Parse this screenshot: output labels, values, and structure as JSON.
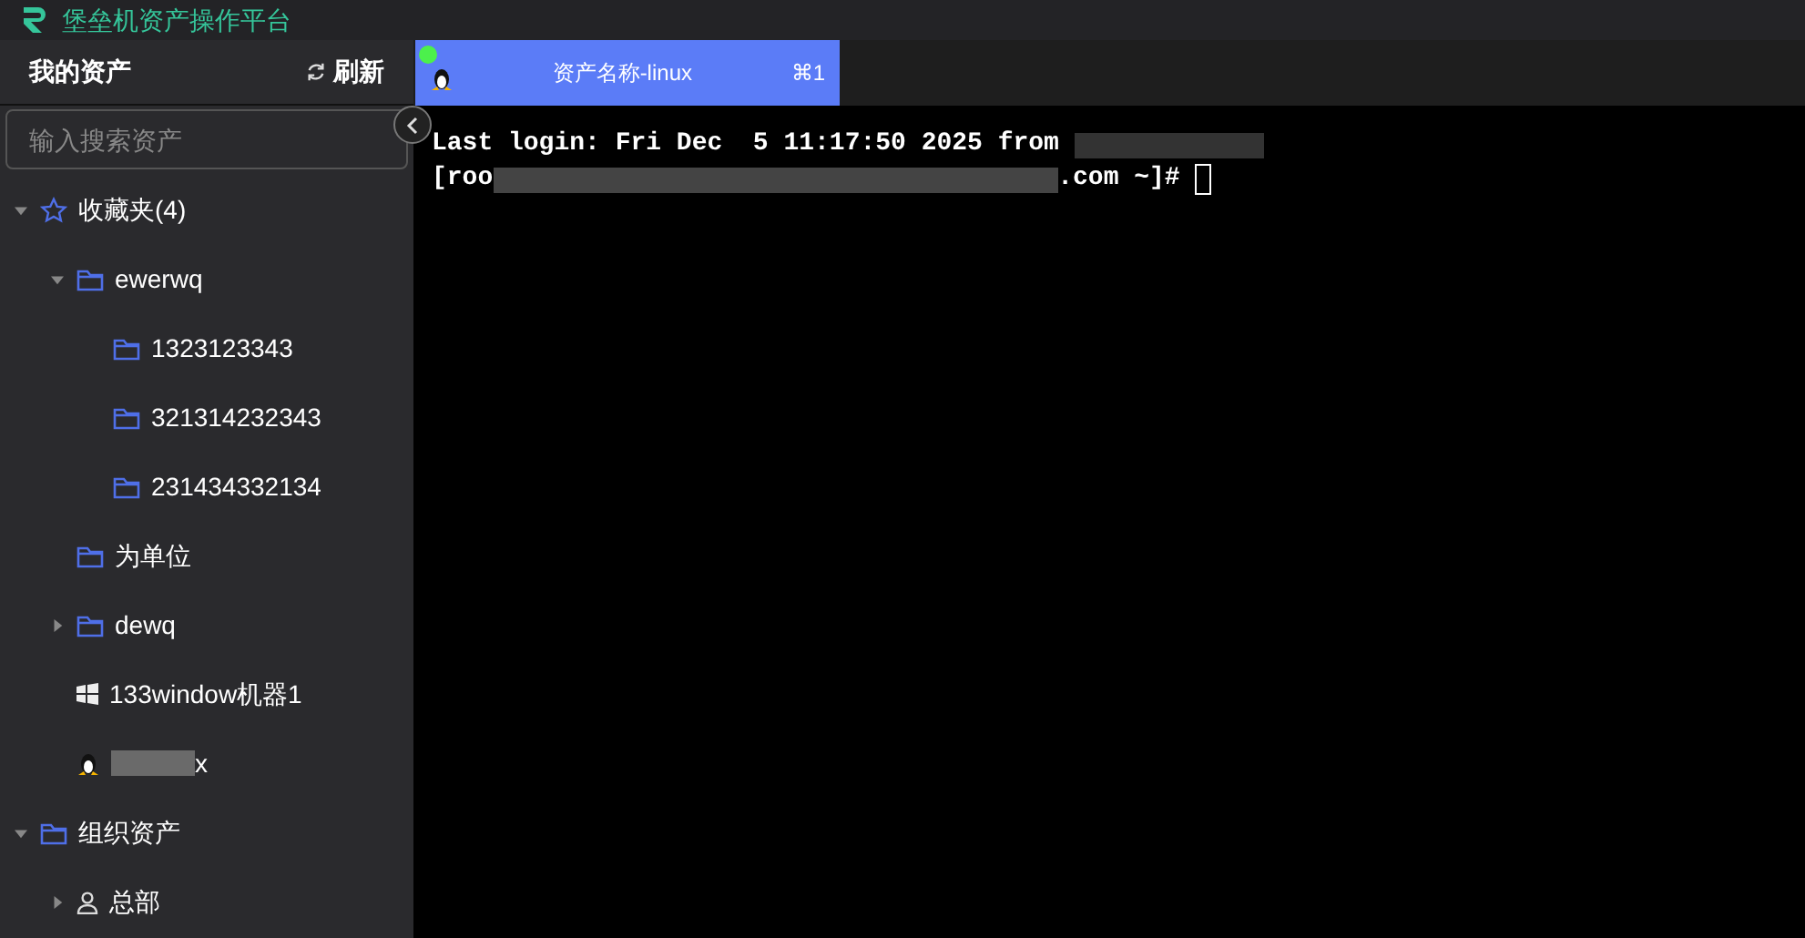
{
  "header": {
    "title": "堡垒机资产操作平台"
  },
  "sidebar": {
    "title": "我的资产",
    "refresh": "刷新",
    "search": {
      "placeholder": "输入搜索资产"
    },
    "tree": [
      {
        "label": "收藏夹(4)",
        "kind": "star",
        "expanded": true,
        "children": [
          {
            "label": "ewerwq",
            "kind": "folder",
            "expanded": true,
            "children": [
              {
                "label": "1323123343",
                "kind": "folder"
              },
              {
                "label": "321314232343",
                "kind": "folder"
              },
              {
                "label": "231434332134",
                "kind": "folder"
              }
            ]
          },
          {
            "label": "为单位",
            "kind": "folder"
          },
          {
            "label": "dewq",
            "kind": "folder",
            "expanded": false
          },
          {
            "label": "133window机器1",
            "kind": "windows"
          },
          {
            "label": "x",
            "kind": "linux",
            "redacted": true
          }
        ]
      },
      {
        "label": "组织资产",
        "kind": "folder",
        "expanded": true,
        "children": [
          {
            "label": "总部",
            "kind": "user",
            "expanded": false
          }
        ]
      }
    ]
  },
  "tabs": [
    {
      "label": "资产名称-linux",
      "shortcut": "⌘1",
      "connected": true,
      "selected": true
    }
  ],
  "terminal": {
    "lines": [
      {
        "before": "Last login: Fri Dec  5 11:17:50 2025 from "
      },
      {
        "before": "[roo",
        "after": ".com ~]# "
      }
    ]
  }
}
